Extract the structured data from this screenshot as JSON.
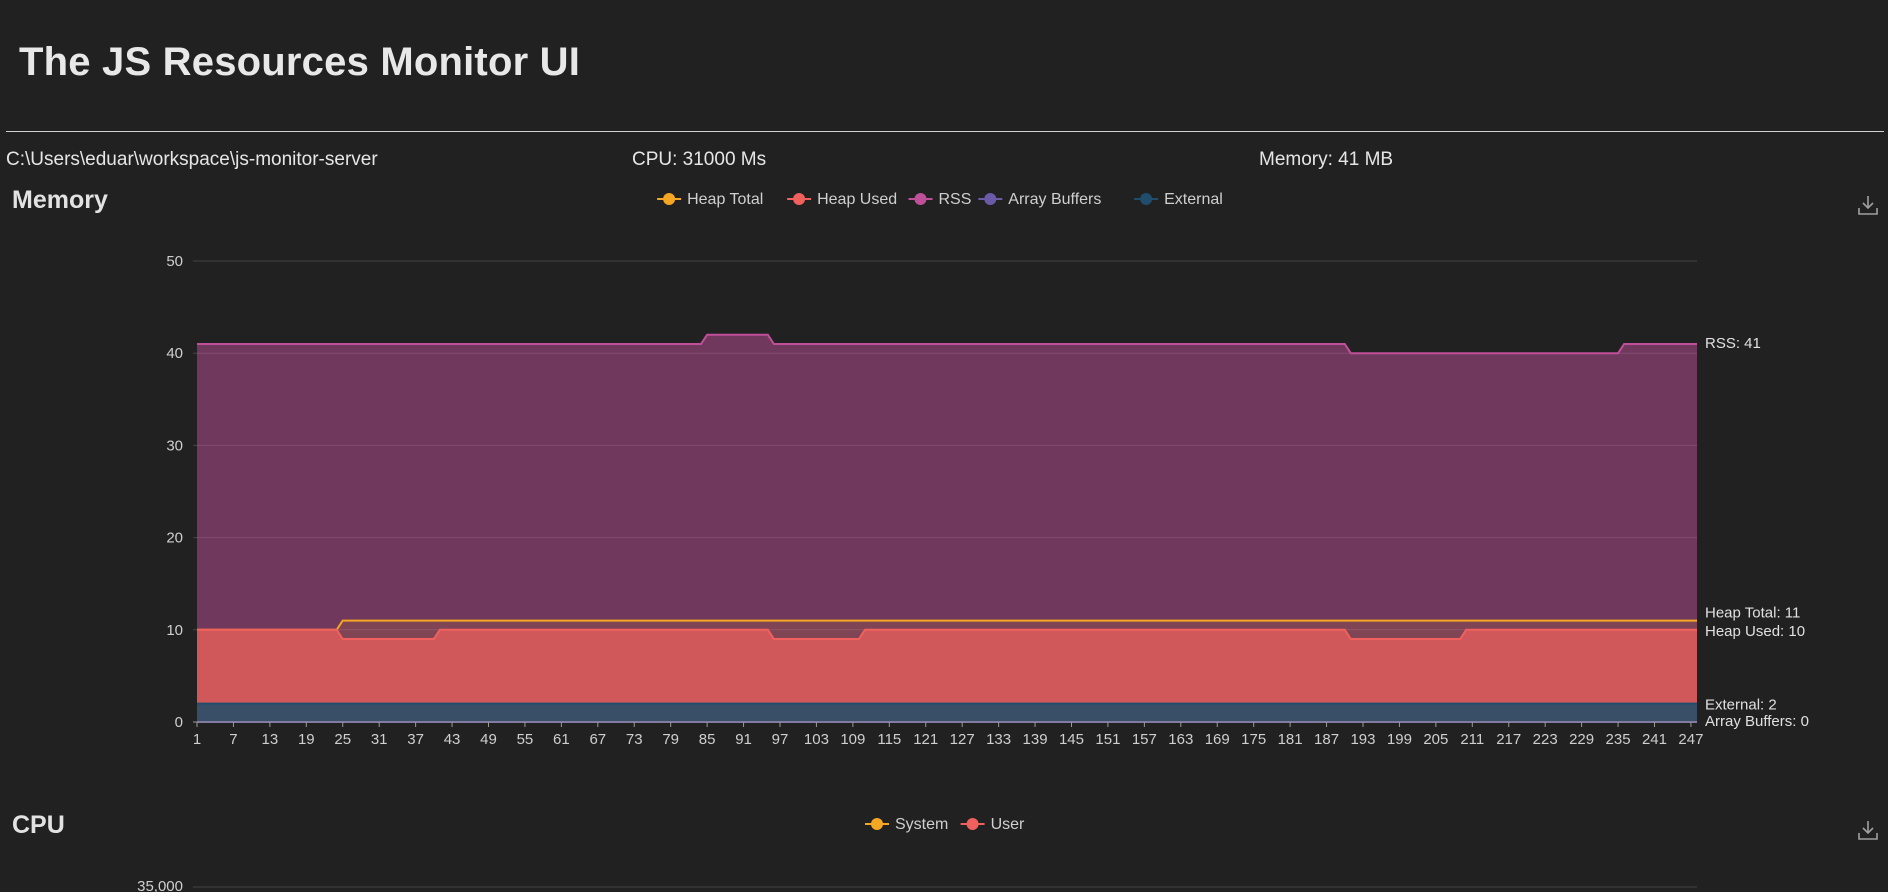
{
  "header": {
    "title": "The JS Resources Monitor UI",
    "path": "C:\\Users\\eduar\\workspace\\js-monitor-server",
    "cpu": "CPU: 31000 Ms",
    "memory": "Memory: 41 MB"
  },
  "memory_section": {
    "title": "Memory"
  },
  "cpu_section": {
    "title": "CPU"
  },
  "colors": {
    "heap_total": "#f5a623",
    "heap_used": "#f0605d",
    "rss": "#c04f9a",
    "array_buffers": "#6b5aa8",
    "external": "#1f4d6b"
  },
  "chart_data": [
    {
      "type": "area",
      "title": "Memory",
      "xlim": [
        1,
        248
      ],
      "x_ticks": [
        1,
        7,
        13,
        19,
        25,
        31,
        37,
        43,
        49,
        55,
        61,
        67,
        73,
        79,
        85,
        91,
        97,
        103,
        109,
        115,
        121,
        127,
        133,
        139,
        145,
        151,
        157,
        163,
        169,
        175,
        181,
        187,
        193,
        199,
        205,
        211,
        217,
        223,
        229,
        235,
        241,
        247
      ],
      "ylim": [
        0,
        50
      ],
      "y_ticks": [
        0,
        10,
        20,
        30,
        40,
        50
      ],
      "grid": true,
      "legend": "top-center",
      "series": [
        {
          "name": "Heap Total",
          "color": "#f5a623",
          "end_label": "Heap Total: 11",
          "steps": [
            [
              1,
              10
            ],
            [
              24,
              10
            ],
            [
              25,
              11
            ],
            [
              248,
              11
            ]
          ]
        },
        {
          "name": "Heap Used",
          "color": "#f0605d",
          "end_label": "Heap Used: 10",
          "steps": [
            [
              1,
              10
            ],
            [
              24,
              10
            ],
            [
              25,
              9
            ],
            [
              40,
              9
            ],
            [
              41,
              10
            ],
            [
              95,
              10
            ],
            [
              96,
              9
            ],
            [
              110,
              9
            ],
            [
              111,
              10
            ],
            [
              190,
              10
            ],
            [
              191,
              9
            ],
            [
              209,
              9
            ],
            [
              210,
              10
            ],
            [
              248,
              10
            ]
          ]
        },
        {
          "name": "RSS",
          "color": "#c04f9a",
          "end_label": "RSS: 41",
          "steps": [
            [
              1,
              41
            ],
            [
              84,
              41
            ],
            [
              85,
              42
            ],
            [
              95,
              42
            ],
            [
              96,
              41
            ],
            [
              190,
              41
            ],
            [
              191,
              40
            ],
            [
              235,
              40
            ],
            [
              236,
              41
            ],
            [
              248,
              41
            ]
          ]
        },
        {
          "name": "Array Buffers",
          "color": "#6b5aa8",
          "end_label": "Array Buffers: 0",
          "steps": [
            [
              1,
              0
            ],
            [
              248,
              0
            ]
          ]
        },
        {
          "name": "External",
          "color": "#1f4d6b",
          "end_label": "External: 2",
          "steps": [
            [
              1,
              2
            ],
            [
              248,
              2
            ]
          ]
        }
      ]
    },
    {
      "type": "area",
      "title": "CPU",
      "legend": "top-center",
      "y_ticks_visible": [
        "35,000"
      ],
      "series": [
        {
          "name": "System",
          "color": "#f5a623"
        },
        {
          "name": "User",
          "color": "#f0605d"
        }
      ]
    }
  ]
}
